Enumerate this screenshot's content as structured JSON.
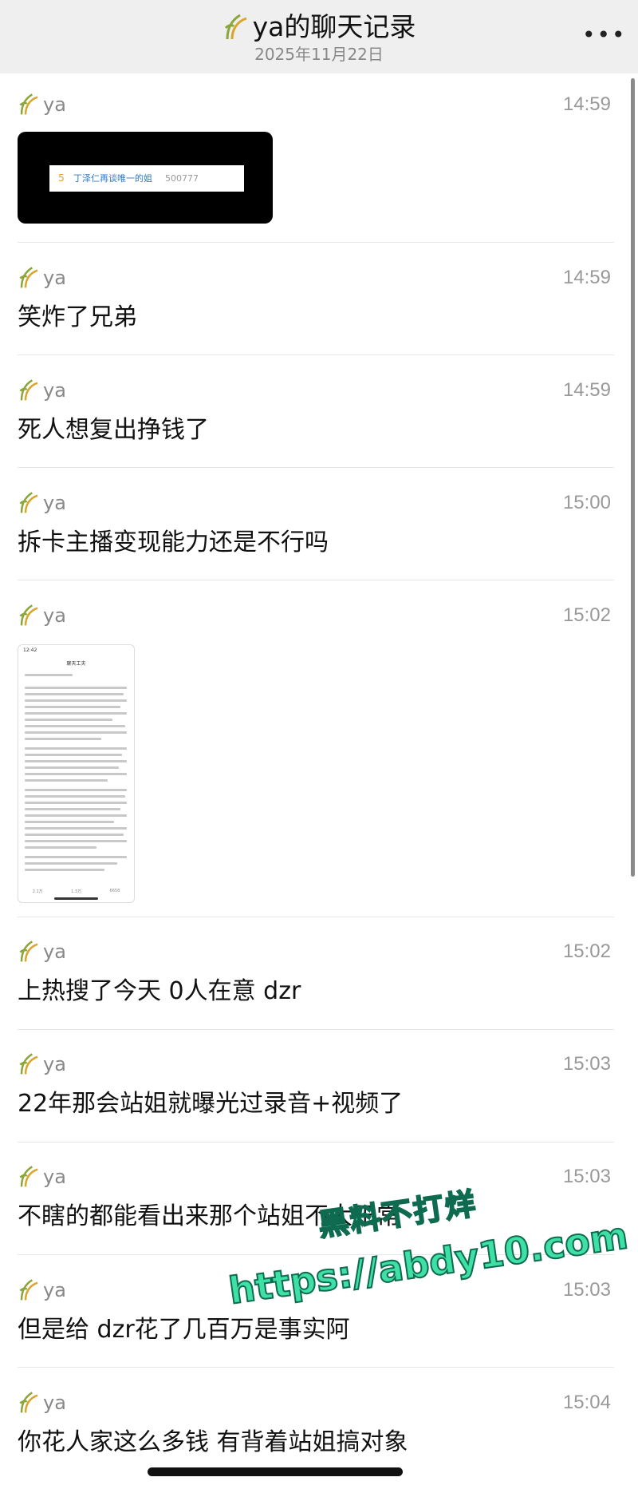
{
  "header": {
    "title": "ya的聊天记录",
    "date": "2025年11月22日",
    "more": "•••"
  },
  "messages": [
    {
      "sender": "ya",
      "time": "14:59",
      "type": "image",
      "image": {
        "rank": "5",
        "title": "丁泽仁再谈唯一的姐",
        "count": "500777"
      }
    },
    {
      "sender": "ya",
      "time": "14:59",
      "type": "text",
      "text": "笑炸了兄弟"
    },
    {
      "sender": "ya",
      "time": "14:59",
      "type": "text",
      "text": "死人想复出挣钱了"
    },
    {
      "sender": "ya",
      "time": "15:00",
      "type": "text",
      "text": "拆卡主播变现能力还是不行吗"
    },
    {
      "sender": "ya",
      "time": "15:02",
      "type": "image",
      "image": {
        "status_time": "12:42",
        "page_title": "聊天工夫",
        "likes": "2.1万",
        "comments": "1.3万",
        "shares": "6658"
      }
    },
    {
      "sender": "ya",
      "time": "15:02",
      "type": "text",
      "text": "上热搜了今天 0人在意 dzr"
    },
    {
      "sender": "ya",
      "time": "15:03",
      "type": "text",
      "text": "22年那会站姐就曝光过录音+视频了"
    },
    {
      "sender": "ya",
      "time": "15:03",
      "type": "text",
      "text": "不瞎的都能看出来那个站姐不大正常"
    },
    {
      "sender": "ya",
      "time": "15:03",
      "type": "text",
      "text": "但是给 dzr花了几百万是事实阿"
    },
    {
      "sender": "ya",
      "time": "15:04",
      "type": "text",
      "text": "你花人家这么多钱 有背着站姐搞对象"
    }
  ],
  "watermark": {
    "line1": "黑料不打烊",
    "line2": "https://abdy10.com"
  },
  "colors": {
    "header_bg": "#efefef",
    "sender": "#888888",
    "time": "#999999",
    "watermark": "#3fe0a6"
  }
}
